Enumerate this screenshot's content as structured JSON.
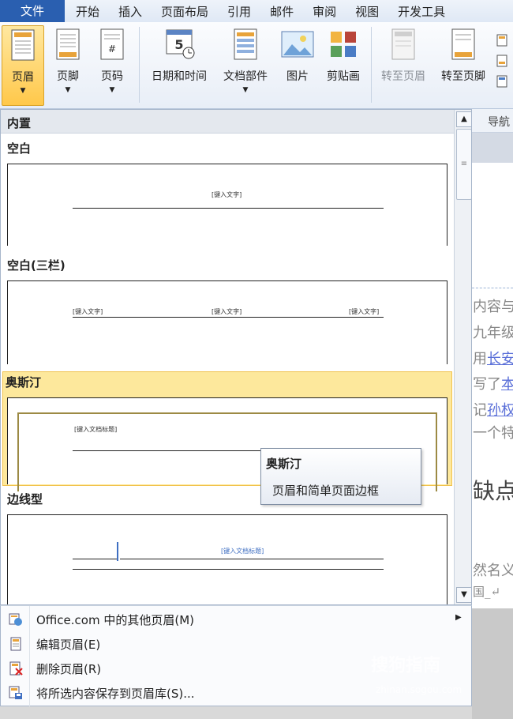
{
  "ribbon_tabs": [
    "文件",
    "开始",
    "插入",
    "页面布局",
    "引用",
    "邮件",
    "审阅",
    "视图",
    "开发工具"
  ],
  "ribbon_buttons": {
    "header": "页眉",
    "footer": "页脚",
    "page_number": "页码",
    "datetime": "日期和时间",
    "quick_parts": "文档部件",
    "picture": "图片",
    "clip_art": "剪贴画",
    "goto_header": "转至页眉",
    "goto_footer": "转至页脚"
  },
  "nav_label": "导航",
  "gallery": {
    "header": "内置",
    "scroll_thumb_glyph": "≡",
    "sections": [
      {
        "title": "空白",
        "placeholder": "[键入文字]"
      },
      {
        "title": "空白(三栏)",
        "placeholders": [
          "[键入文字]",
          "[键入文字]",
          "[键入文字]"
        ]
      },
      {
        "title": "奥斯汀",
        "placeholder": "[键入文档标题]"
      },
      {
        "title": "边线型",
        "placeholder": "[键入文档标题]"
      }
    ]
  },
  "tooltip": {
    "title": "奥斯汀",
    "body": "页眉和简单页面边框"
  },
  "menu_items": [
    {
      "label": "Office.com 中的其他页眉(M)",
      "has_submenu": true
    },
    {
      "label": "编辑页眉(E)"
    },
    {
      "label": "删除页眉(R)"
    },
    {
      "label": "将所选内容保存到页眉库(S)..."
    }
  ],
  "doc_text": {
    "lines": [
      "内容与",
      "九年级",
      "用长安",
      "写了本",
      "记孙权",
      "一个特"
    ],
    "heading": "缺点",
    "footer_lines": [
      "然名义",
      "国_↵"
    ]
  },
  "watermark": {
    "main": "搜狗指南",
    "sub": "zhinan.sogou.com"
  }
}
